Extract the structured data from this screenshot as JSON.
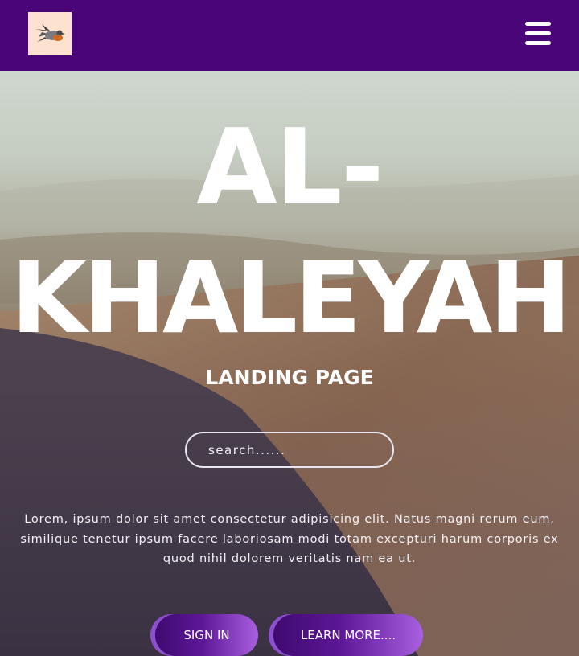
{
  "navbar": {
    "logo_icon": "bird-logo-icon",
    "menu_icon": "hamburger-menu-icon",
    "background": "#4a0578"
  },
  "hero": {
    "title_line1": "AL-",
    "title_line2": "KHALEYAH",
    "subtitle": "LANDING PAGE",
    "search_placeholder": "search......",
    "description": "Lorem, ipsum dolor sit amet consectetur adipisicing elit. Natus magni rerum eum, similique tenetur ipsum facere laboriosam modi totam excepturi harum corporis ex quod nihil dolorem veritatis nam ea ut.",
    "signin_label": "SIGN IN",
    "learn_more_label": "LEARN MORE....",
    "button_colors": [
      "#3f0a70",
      "#a85fe0"
    ]
  }
}
